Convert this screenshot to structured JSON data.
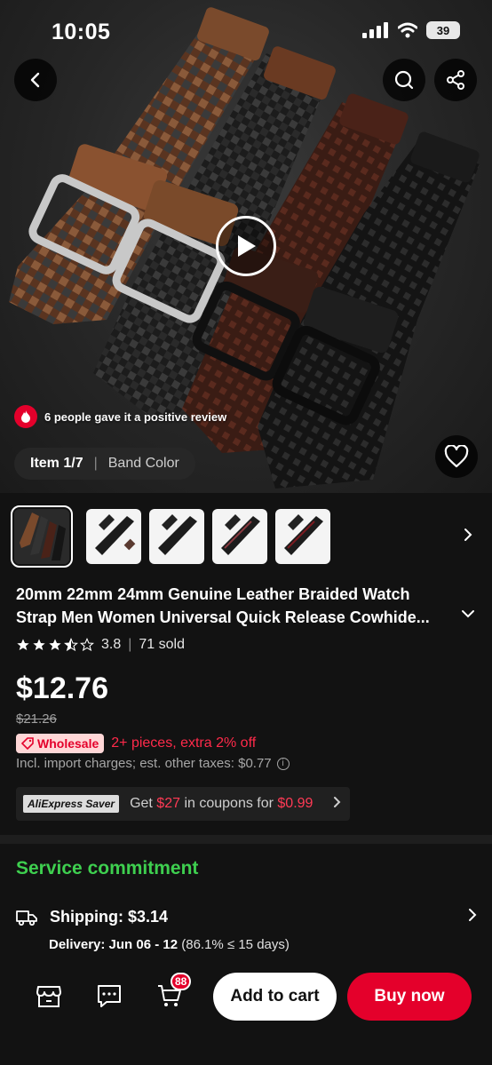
{
  "status_bar": {
    "time": "10:05",
    "battery": "39"
  },
  "hero": {
    "review_text": "6 people gave it a positive review",
    "item_index": "Item 1/7",
    "item_label": "Band Color"
  },
  "product": {
    "title_line1": "20mm 22mm 24mm Genuine Leather Braided Watch",
    "title_line2": "Strap Men Women Universal Quick Release Cowhide...",
    "rating": "3.8",
    "sold": "71 sold",
    "rating_stars": 3.5,
    "price": "$12.76",
    "old_price": "$21.26",
    "wholesale_badge": "Wholesale",
    "wholesale_text": "2+ pieces, extra 2% off",
    "tax_text": "Incl. import charges; est. other taxes: $0.77"
  },
  "saver": {
    "logo": "AliExpress Saver",
    "text_prefix": "Get ",
    "coupon_amount": "$27",
    "text_mid": " in coupons for ",
    "price": "$0.99"
  },
  "service": {
    "title": "Service commitment",
    "shipping": "Shipping: $3.14",
    "delivery_label": "Delivery: Jun 06 - 12",
    "delivery_detail": " (86.1% ≤ 15 days)"
  },
  "bottom": {
    "cart_count": "88",
    "add_to_cart": "Add to cart",
    "buy_now": "Buy now"
  },
  "colors": {
    "accent": "#e4002b",
    "green": "#3ecf4f",
    "price_red": "#ff2a4a"
  }
}
